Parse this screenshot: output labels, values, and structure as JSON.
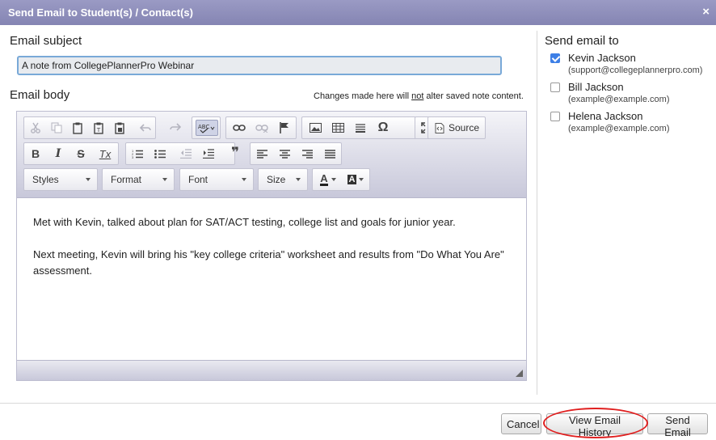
{
  "dialog": {
    "title": "Send Email to Student(s) / Contact(s)",
    "close_icon": "×"
  },
  "subject": {
    "label": "Email subject",
    "value": "A note from CollegePlannerPro Webinar"
  },
  "body": {
    "label": "Email body",
    "note_prefix": "Changes made here will ",
    "note_emph": "not",
    "note_suffix": " alter saved note content.",
    "paragraph1": "Met with Kevin, talked about plan for SAT/ACT testing, college list and goals for junior year.",
    "paragraph2": "Next meeting, Kevin will bring his \"key college criteria\" worksheet and results from \"Do What You Are\" assessment."
  },
  "toolbar": {
    "source_label": "Source",
    "styles_label": "Styles",
    "format_label": "Format",
    "font_label": "Font",
    "size_label": "Size",
    "bold": "B",
    "italic": "I",
    "strike": "S",
    "remove_format": "Tx",
    "blockquote": "❞",
    "special_char": "Ω",
    "text_color": "A",
    "bg_color": "A"
  },
  "recipients": {
    "label": "Send email to",
    "list": [
      {
        "name": "Kevin Jackson",
        "email": "(support@collegeplannerpro.com)",
        "checked": true
      },
      {
        "name": "Bill Jackson",
        "email": "(example@example.com)",
        "checked": false
      },
      {
        "name": "Helena Jackson",
        "email": "(example@example.com)",
        "checked": false
      }
    ]
  },
  "footer": {
    "cancel_label": "Cancel",
    "history_label": "View Email History",
    "send_label": "Send Email"
  },
  "colors": {
    "title_bar": "#8787b5",
    "checkbox_checked": "#3d7fe6",
    "highlight_oval": "#e02020"
  }
}
